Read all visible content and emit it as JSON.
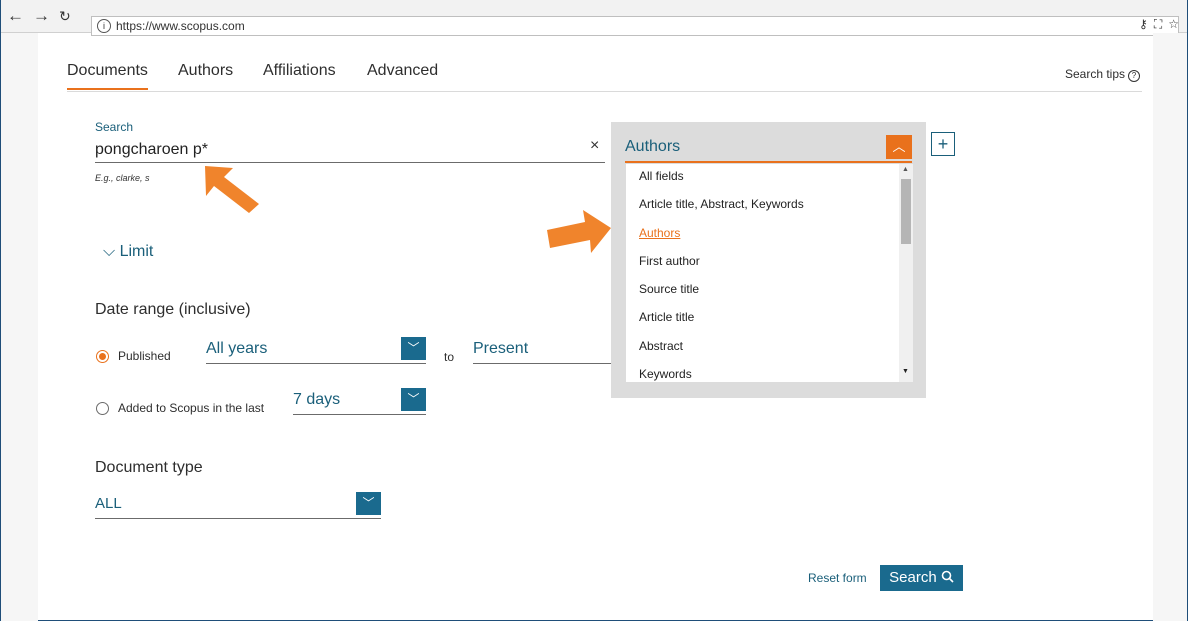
{
  "browser": {
    "url": "https://www.scopus.com",
    "info_glyph": "i",
    "right_icons": [
      "key-icon",
      "translate-icon",
      "star-icon"
    ]
  },
  "tabs": [
    "Documents",
    "Authors",
    "Affiliations",
    "Advanced"
  ],
  "search_tips": "Search tips",
  "search": {
    "label": "Search",
    "value": "pongcharoen p*",
    "hint": "E.g., clarke, s",
    "clear_glyph": "×"
  },
  "field": {
    "selected": "Authors",
    "options": [
      "All fields",
      "Article title, Abstract, Keywords",
      "Authors",
      "First author",
      "Source title",
      "Article title",
      "Abstract",
      "Keywords"
    ],
    "selected_index": 2
  },
  "add_glyph": "+",
  "limit": "Limit",
  "date_range": {
    "heading": "Date range (inclusive)",
    "published_label": "Published",
    "from": "All years",
    "to_label": "to",
    "to": "Present",
    "added_label": "Added to Scopus in the last",
    "added_value": "7 days"
  },
  "document_type": {
    "heading": "Document type",
    "value": "ALL"
  },
  "actions": {
    "reset": "Reset form",
    "search": "Search"
  },
  "colors": {
    "accent_orange": "#e9711c",
    "brand_blue": "#1a6a8e",
    "annotation_arrow": "#f0842c"
  }
}
